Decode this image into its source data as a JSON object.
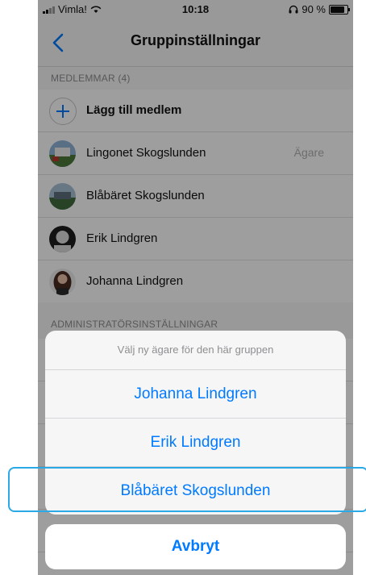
{
  "status_bar": {
    "carrier": "Vimla!",
    "time": "10:18",
    "battery": "90 %"
  },
  "nav": {
    "title": "Gruppinställningar"
  },
  "members": {
    "header": "MEDLEMMAR (4)",
    "add_label": "Lägg till medlem",
    "items": [
      {
        "name": "Lingonet Skogslunden",
        "role": "Ägare"
      },
      {
        "name": "Blåbäret Skogslunden",
        "role": ""
      },
      {
        "name": "Erik Lindgren",
        "role": ""
      },
      {
        "name": "Johanna Lindgren",
        "role": ""
      }
    ]
  },
  "admin": {
    "header": "ADMINISTRATÖRSINSTÄLLNINGAR"
  },
  "action_sheet": {
    "title": "Välj ny ägare för den här gruppen",
    "options": [
      "Johanna Lindgren",
      "Erik Lindgren",
      "Blåbäret Skogslunden"
    ],
    "cancel": "Avbryt"
  },
  "colors": {
    "accent": "#007aff",
    "highlight": "#2aa9e6"
  }
}
